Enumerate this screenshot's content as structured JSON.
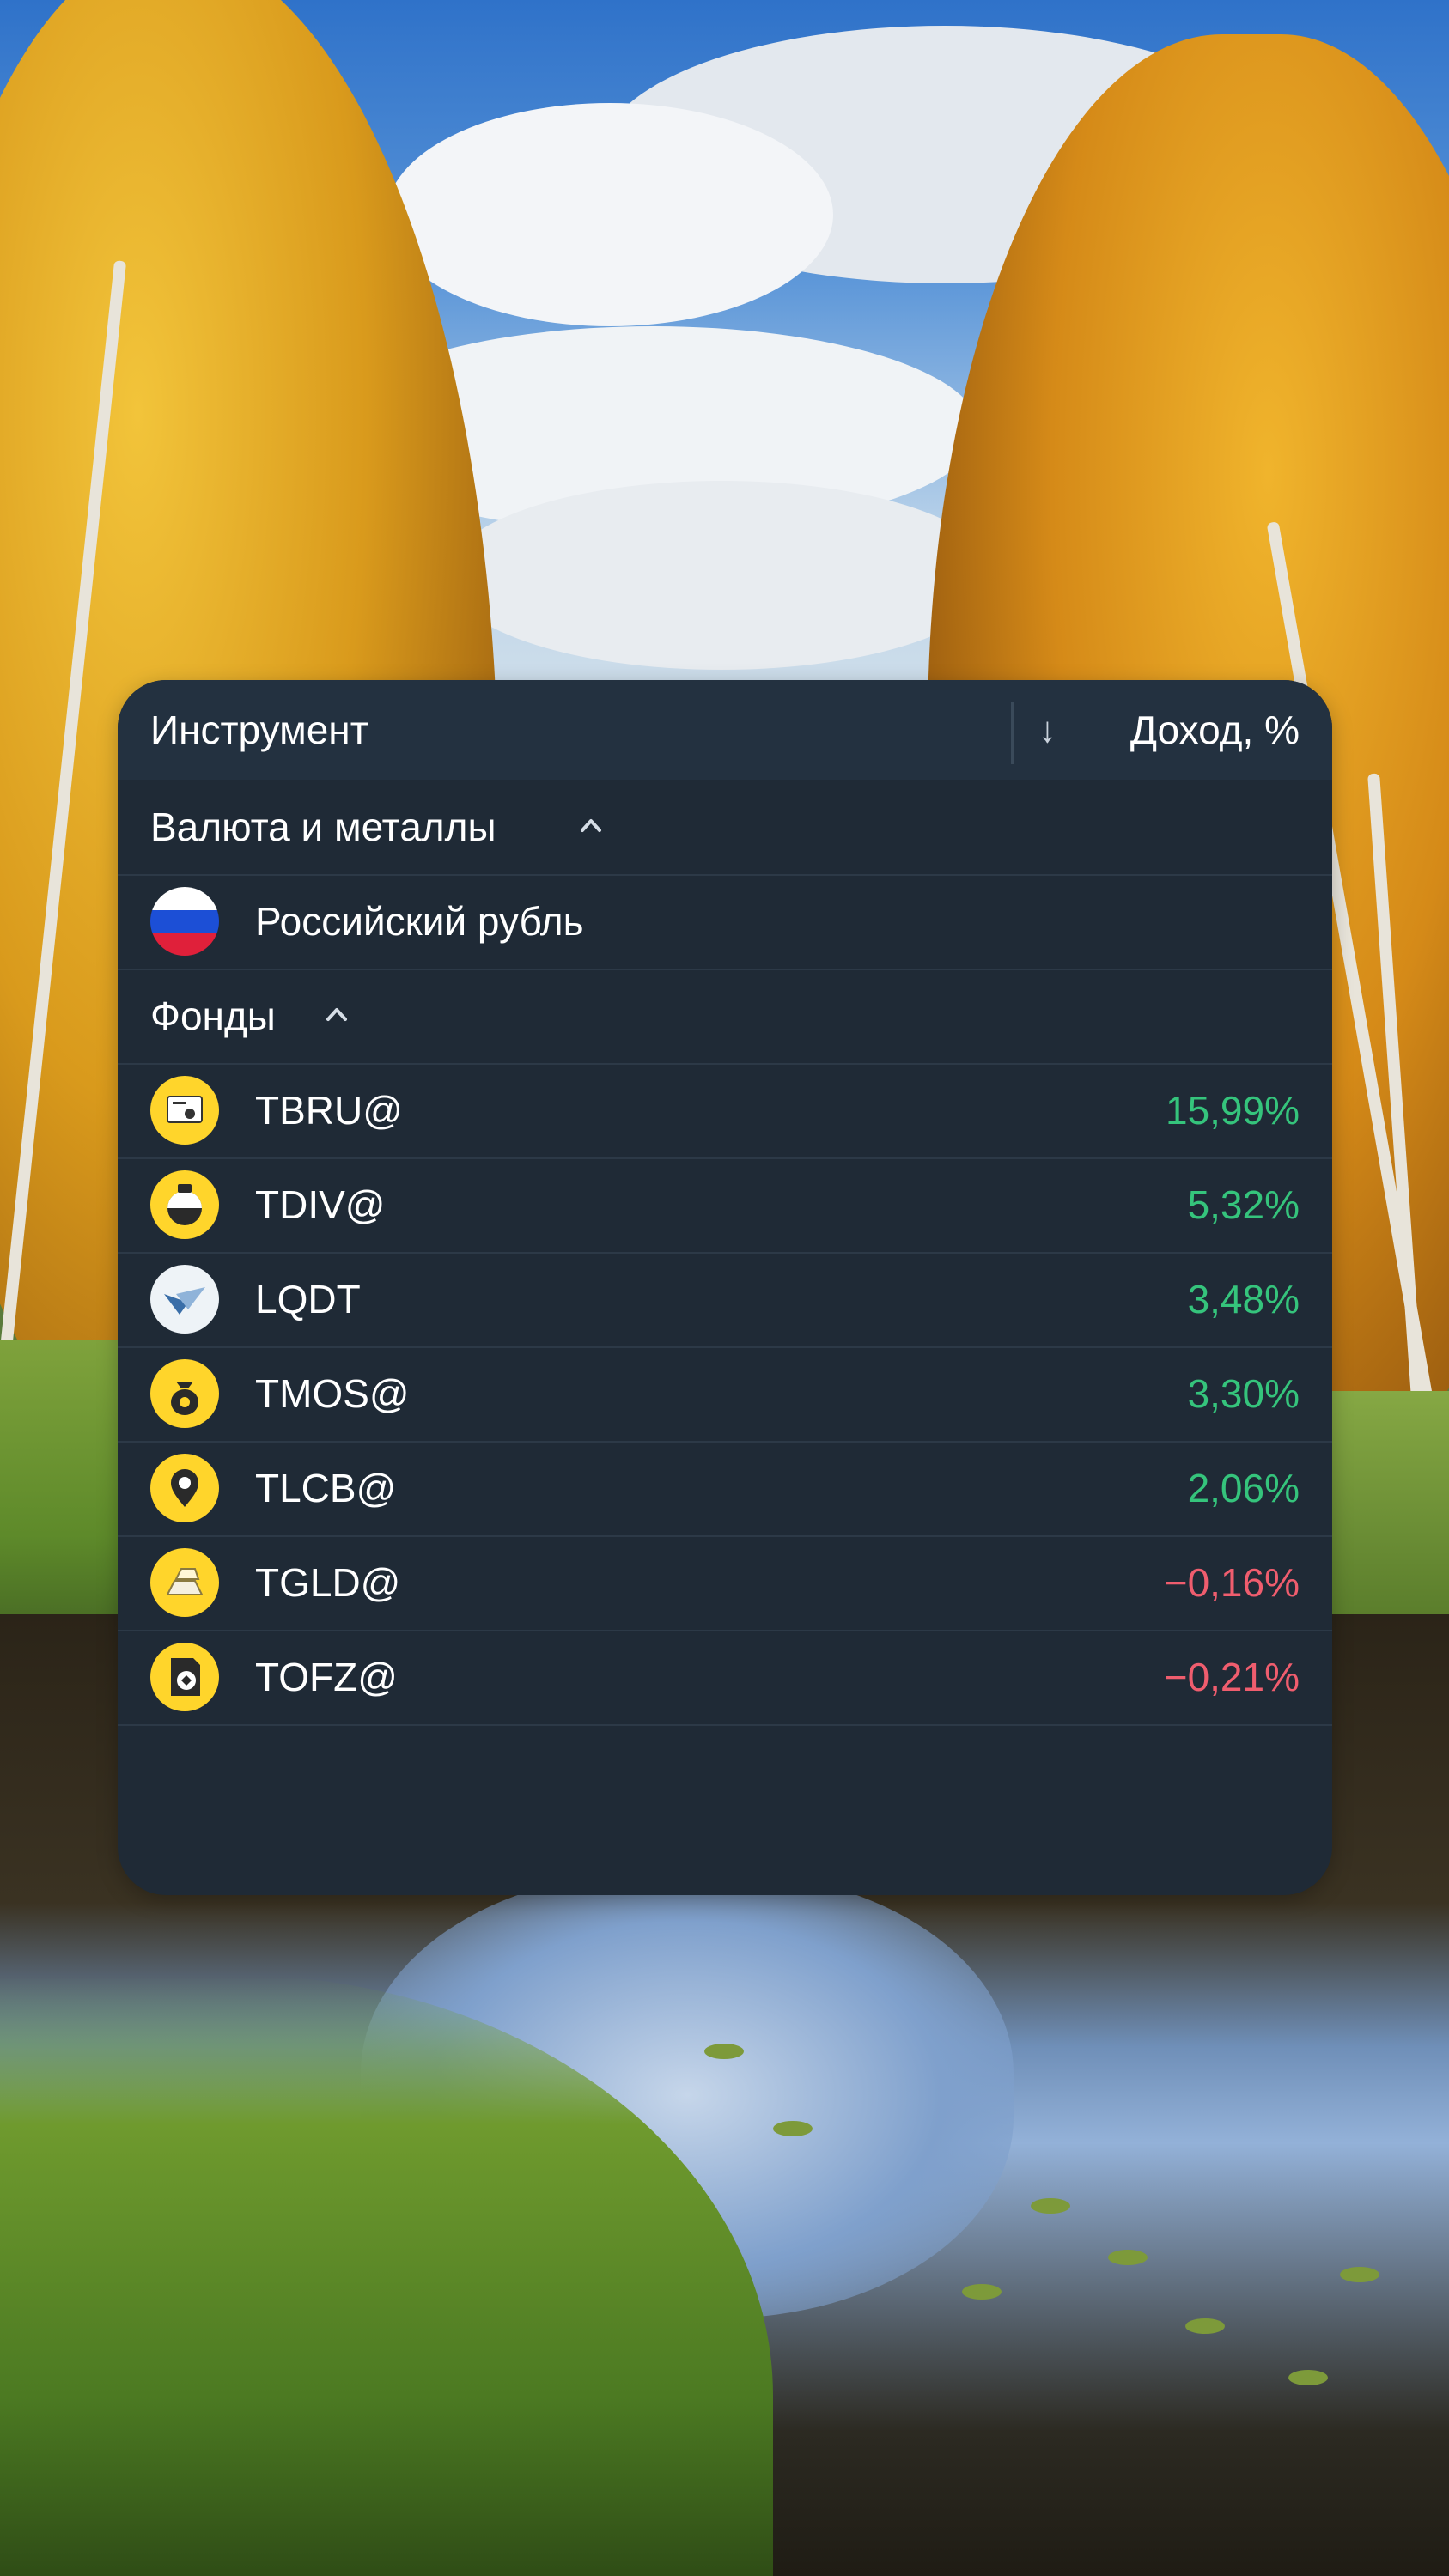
{
  "widget": {
    "header": {
      "instrument_label": "Инструмент",
      "sort_arrow": "↓",
      "value_label": "Доход, %"
    },
    "groups": [
      {
        "label": "Валюта и металлы",
        "items": [
          {
            "name": "Российский рубль",
            "value": "",
            "icon": "russia-flag-icon"
          }
        ]
      },
      {
        "label": "Фонды",
        "items": [
          {
            "name": "TBRU@",
            "value": "15,99%",
            "trend": "positive",
            "icon": "certificate-icon"
          },
          {
            "name": "TDIV@",
            "value": "5,32%",
            "trend": "positive",
            "icon": "coin-stack-icon"
          },
          {
            "name": "LQDT",
            "value": "3,48%",
            "trend": "positive",
            "icon": "liquidity-fund-logo-icon"
          },
          {
            "name": "TMOS@",
            "value": "3,30%",
            "trend": "positive",
            "icon": "money-bag-icon"
          },
          {
            "name": "TLCB@",
            "value": "2,06%",
            "trend": "positive",
            "icon": "location-pin-icon"
          },
          {
            "name": "TGLD@",
            "value": "−0,16%",
            "trend": "negative",
            "icon": "gold-bar-icon"
          },
          {
            "name": "TOFZ@",
            "value": "−0,21%",
            "trend": "negative",
            "icon": "state-bond-icon"
          }
        ]
      }
    ]
  },
  "colors": {
    "widget_bg": "#1f2a36",
    "header_bg": "#233140",
    "positive": "#35c47c",
    "negative": "#ef5d6e",
    "fund_icon_yellow": "#ffd52b"
  }
}
